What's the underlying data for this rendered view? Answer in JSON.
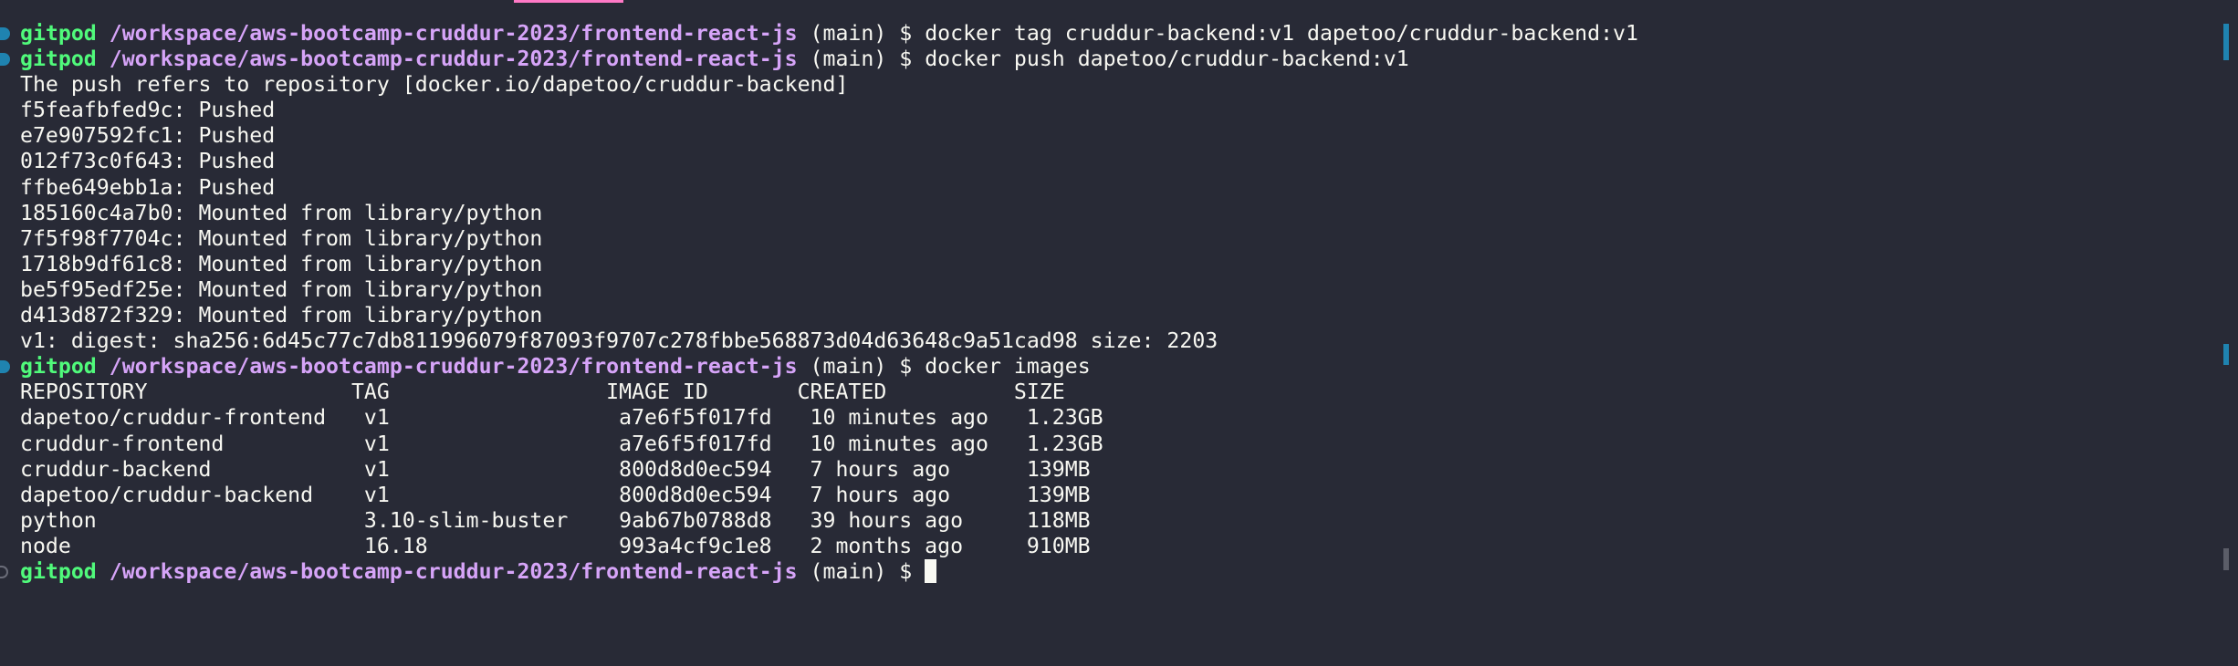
{
  "prompt": {
    "user": "gitpod",
    "path": "/workspace/aws-bootcamp-cruddur-2023/frontend-react-js",
    "branch": "(main) $"
  },
  "commands": [
    "docker tag cruddur-backend:v1 dapetoo/cruddur-backend:v1",
    "docker push dapetoo/cruddur-backend:v1",
    "docker images"
  ],
  "push_output": [
    "The push refers to repository [docker.io/dapetoo/cruddur-backend]",
    "f5feafbfed9c: Pushed",
    "e7e907592fc1: Pushed",
    "012f73c0f643: Pushed",
    "ffbe649ebb1a: Pushed",
    "185160c4a7b0: Mounted from library/python",
    "7f5f98f7704c: Mounted from library/python",
    "1718b9df61c8: Mounted from library/python",
    "be5f95edf25e: Mounted from library/python",
    "d413d872f329: Mounted from library/python",
    "v1: digest: sha256:6d45c77c7db811996079f87093f9707c278fbbe568873d04d63648c9a51cad98 size: 2203"
  ],
  "images_table": [
    "REPOSITORY                TAG                 IMAGE ID       CREATED          SIZE",
    "dapetoo/cruddur-frontend   v1                  a7e6f5f017fd   10 minutes ago   1.23GB",
    "cruddur-frontend           v1                  a7e6f5f017fd   10 minutes ago   1.23GB",
    "cruddur-backend            v1                  800d8d0ec594   7 hours ago      139MB",
    "dapetoo/cruddur-backend    v1                  800d8d0ec594   7 hours ago      139MB",
    "python                     3.10-slim-buster    9ab67b0788d8   39 hours ago     118MB",
    "node                       16.18               993a4cf9c1e8   2 months ago     910MB"
  ],
  "colors": {
    "background": "#282a36",
    "user": "#50fa7b",
    "path": "#d6a4f8",
    "marker": "#1f83b0"
  }
}
